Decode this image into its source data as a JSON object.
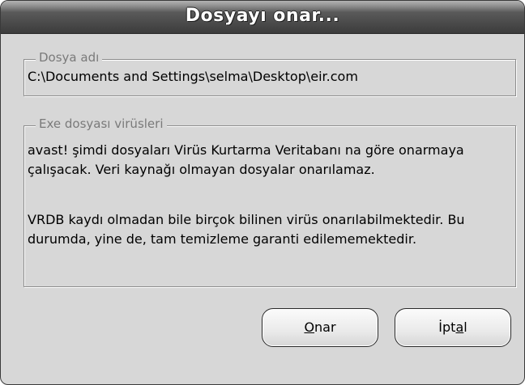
{
  "window": {
    "title": "Dosyayı onar..."
  },
  "file_group": {
    "legend": "Dosya adı",
    "path": "C:\\Documents and Settings\\selma\\Desktop\\eir.com"
  },
  "virus_group": {
    "legend": "Exe dosyası virüsleri",
    "paragraphs": [
      "avast! şimdi dosyaları Virüs Kurtarma Veritabanı na göre onarmaya çalışacak. Veri kaynağı olmayan dosyalar onarılamaz.",
      "VRDB kaydı olmadan bile birçok bilinen virüs onarılabilmektedir. Bu durumda, yine de, tam temizleme garanti edilememektedir."
    ]
  },
  "buttons": {
    "repair": {
      "accel": "O",
      "rest": "nar"
    },
    "cancel": {
      "before": "İpt",
      "accel": "a",
      "after": "l"
    }
  }
}
